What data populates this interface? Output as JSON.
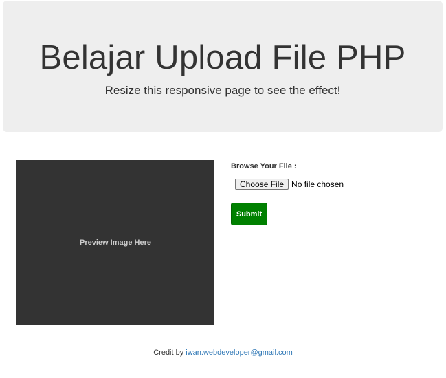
{
  "header": {
    "title": "Belajar Upload File PHP",
    "subtitle": "Resize this responsive page to see the effect!"
  },
  "preview": {
    "placeholder_text": "Preview Image Here"
  },
  "form": {
    "file_label": "Browse Your File :",
    "choose_file_label": "Choose File",
    "file_status": "No file chosen",
    "submit_label": "Submit"
  },
  "footer": {
    "credit_prefix": "Credit by",
    "email": "iwan.webdeveloper@gmail.com"
  },
  "colors": {
    "jumbotron_bg": "#eeeeee",
    "preview_bg": "#333333",
    "submit_bg": "#008000",
    "link": "#337ab7"
  }
}
